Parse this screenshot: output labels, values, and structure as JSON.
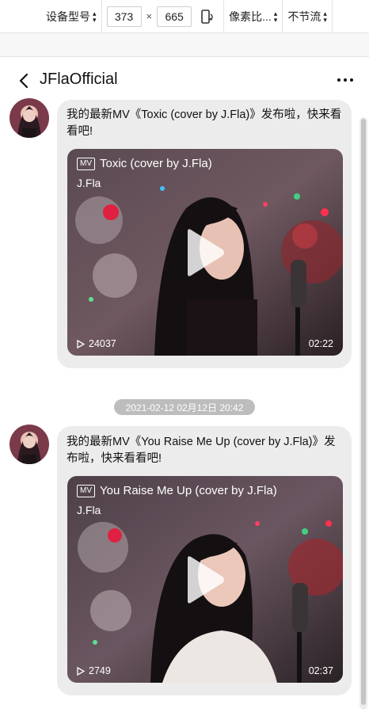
{
  "devtools": {
    "device_model": "设备型号",
    "width": "373",
    "times": "×",
    "height": "665",
    "pixel_ratio": "像素比...",
    "throttle": "不节流"
  },
  "header": {
    "title": "JFlaOfficial"
  },
  "messages": [
    {
      "text": "我的最新MV《Toxic (cover by J.Fla)》发布啦，快来看看吧!",
      "card": {
        "badge": "MV",
        "title": "Toxic (cover by J.Fla)",
        "artist": "J.Fla",
        "views": "24037",
        "duration": "02:22"
      }
    },
    {
      "text": "我的最新MV《You Raise Me Up (cover by J.Fla)》发布啦，快来看看吧!",
      "card": {
        "badge": "MV",
        "title": "You Raise Me Up (cover by J.Fla)",
        "artist": "J.Fla",
        "views": "2749",
        "duration": "02:37"
      }
    }
  ],
  "timestamp": "2021-02-12 02月12日 20:42",
  "colors": {
    "bubble": "#ececec",
    "timestamp_chip": "#bdbdbd",
    "card_dark": "#2a1f22"
  }
}
